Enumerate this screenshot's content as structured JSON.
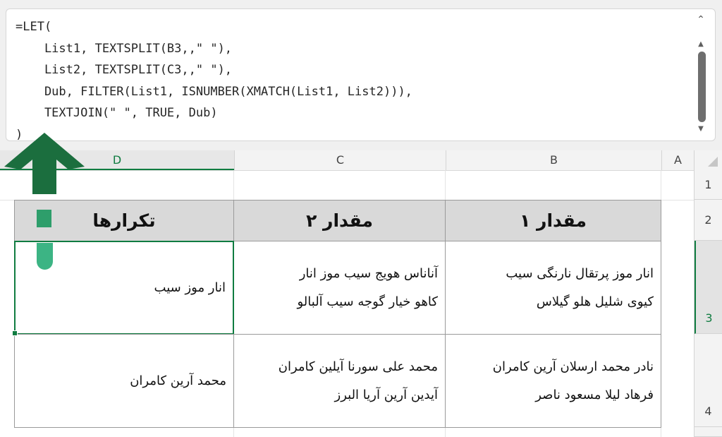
{
  "formula_bar": {
    "lines": [
      "=LET(",
      "    List1, TEXTSPLIT(B3,,\" \"),",
      "    List2, TEXTSPLIT(C3,,\" \"),",
      "    Dub, FILTER(List1, ISNUMBER(XMATCH(List1, List2))),",
      "    TEXTJOIN(\" \", TRUE, Dub)",
      ")"
    ],
    "collapse_icon": "chevron-up-icon"
  },
  "columns": [
    {
      "label": "D",
      "selected": true
    },
    {
      "label": "C",
      "selected": false
    },
    {
      "label": "B",
      "selected": false
    },
    {
      "label": "A",
      "selected": false
    }
  ],
  "rows": [
    {
      "label": "1",
      "selected": false
    },
    {
      "label": "2",
      "selected": false
    },
    {
      "label": "3",
      "selected": true
    },
    {
      "label": "4",
      "selected": false
    }
  ],
  "table": {
    "headers": {
      "b": "مقدار ۱",
      "c": "مقدار ۲",
      "d": "تکرارها"
    },
    "row3": {
      "b": "انار موز پرتقال نارنگی سیب\nکیوی شلیل هلو گیلاس",
      "c": "آناناس هویج سیب موز انار\nکاهو خیار گوجه سیب آلبالو",
      "d": "انار موز سیب"
    },
    "row4": {
      "b": "نادر محمد ارسلان آرین کامران\nفرهاد لیلا مسعود ناصر",
      "c": "محمد علی سورنا آیلین کامران\nآیدین آرین آریا البرز",
      "d": "محمد آرین کامران"
    }
  },
  "colors": {
    "accent": "#107c41",
    "arrow": "#1b6e3e",
    "header_fill": "#d9d9d9"
  }
}
